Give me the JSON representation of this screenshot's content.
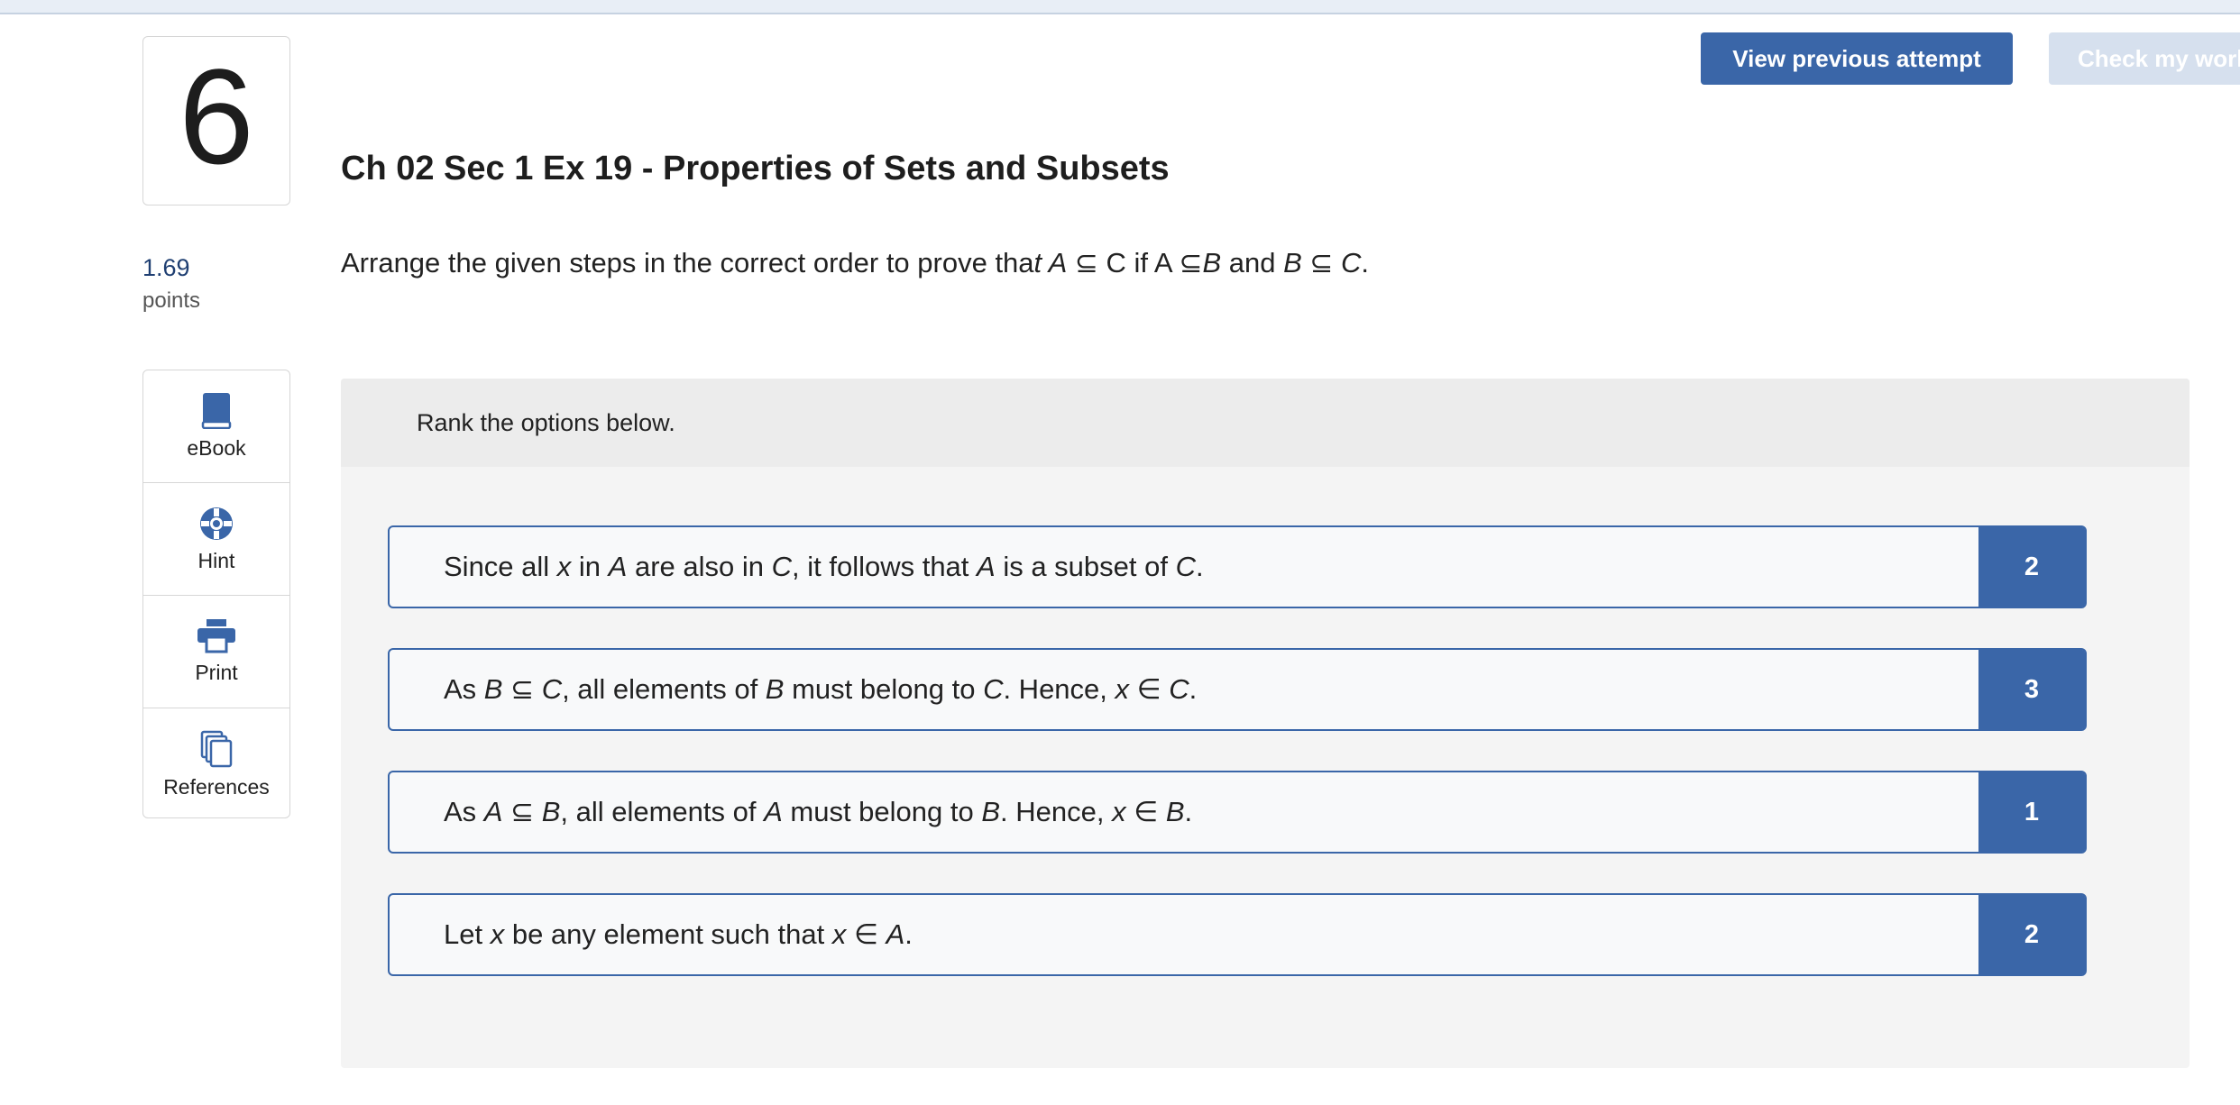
{
  "question": {
    "number": "6",
    "points_value": "1.69",
    "points_label": "points",
    "title": "Ch 02 Sec 1 Ex 19 - Properties of Sets and Subsets"
  },
  "prompt": {
    "lead": "Arrange the given steps in the correct order to prove tha",
    "p1": "t A",
    "p2": " ⊆ C if A ⊆",
    "p3": "B",
    "p4": " and ",
    "p5": "B",
    "p6": " ⊆ ",
    "p7": "C",
    "p8": "."
  },
  "toolbar": {
    "view_previous": "View previous attempt",
    "check_work": "Check my work"
  },
  "tools": [
    {
      "label": "eBook",
      "icon": "book-icon"
    },
    {
      "label": "Hint",
      "icon": "lifebuoy-icon"
    },
    {
      "label": "Print",
      "icon": "printer-icon"
    },
    {
      "label": "References",
      "icon": "documents-icon"
    }
  ],
  "ranking": {
    "instruction": "Rank the options below.",
    "items": [
      {
        "rank": "2",
        "parts": {
          "a": "Since all ",
          "b": "x",
          "c": " in ",
          "d": "A",
          "e": " are also in ",
          "f": "C",
          "g": ", it follows that ",
          "h": "A",
          "i": " is a subset of ",
          "j": "C",
          "k": "."
        }
      },
      {
        "rank": "3",
        "parts": {
          "a": "As ",
          "b": "B",
          "c": " ⊆ ",
          "d": "C",
          "e": ", all elements of ",
          "f": "B",
          "g": " must belong to ",
          "h": "C",
          "i": ". Hence, ",
          "j": "x",
          "k": " ∈ ",
          "l": "C",
          "m": "."
        }
      },
      {
        "rank": "1",
        "parts": {
          "a": "As ",
          "b": "A",
          "c": " ⊆ ",
          "d": "B",
          "e": ", all elements of ",
          "f": "A",
          "g": " must belong to ",
          "h": "B",
          "i": ". Hence, ",
          "j": "x",
          "k": " ∈ ",
          "l": "B",
          "m": "."
        }
      },
      {
        "rank": "2",
        "parts": {
          "a": "Let ",
          "b": "x",
          "c": " be any element such that ",
          "d": "x",
          "e": " ∈ ",
          "f": "A",
          "g": "."
        }
      }
    ]
  },
  "colors": {
    "accent": "#3a66a8",
    "disabled_button": "#d6e0ee",
    "panel_bg": "#f4f4f4",
    "panel_header_bg": "#ececec"
  }
}
